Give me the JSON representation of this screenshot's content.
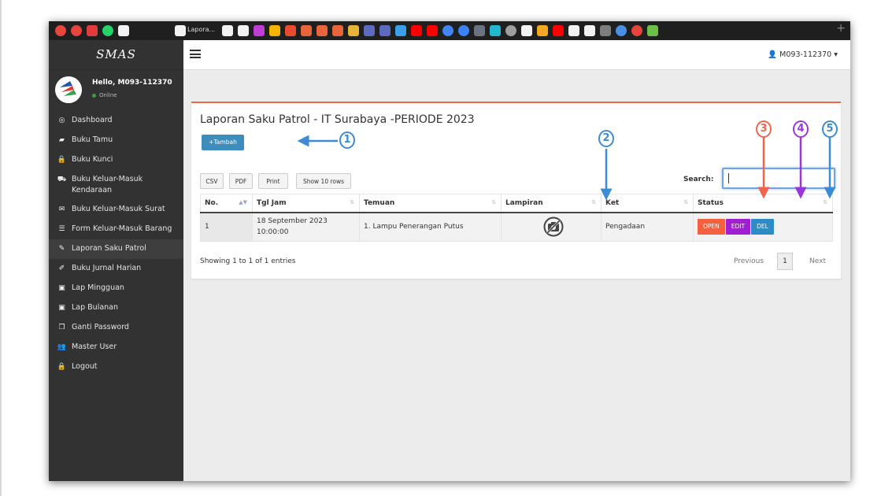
{
  "tabs": {
    "title": "Lapora...",
    "icons": [
      {
        "name": "google-icon",
        "color": "#e8453c",
        "round": true
      },
      {
        "name": "google-icon",
        "color": "#e8453c",
        "round": true
      },
      {
        "name": "app-icon",
        "color": "#e23b3b",
        "round": false
      },
      {
        "name": "whatsapp-icon",
        "color": "#25d366",
        "round": true
      },
      {
        "name": "github-icon",
        "color": "#f2f2f2",
        "round": false
      },
      {
        "name": "github-icon",
        "color": "#f2f2f2",
        "round": false
      },
      {
        "name": "github-icon",
        "color": "#f2f2f2",
        "round": false
      },
      {
        "name": "github-icon",
        "color": "#f2f2f2",
        "round": false
      },
      {
        "name": "slack-icon",
        "color": "#c13ed6",
        "round": false
      },
      {
        "name": "drive-icon",
        "color": "#f4b400",
        "round": false
      },
      {
        "name": "app-icon",
        "color": "#e84b2f",
        "round": false
      },
      {
        "name": "cp-icon",
        "color": "#e8643b",
        "round": false
      },
      {
        "name": "cp-icon",
        "color": "#e8643b",
        "round": false
      },
      {
        "name": "cp-icon",
        "color": "#e8643b",
        "round": false
      },
      {
        "name": "app-icon",
        "color": "#e6b33a",
        "round": false
      },
      {
        "name": "app-icon",
        "color": "#5c6bc0",
        "round": false
      },
      {
        "name": "app-icon",
        "color": "#5c6bc0",
        "round": false
      },
      {
        "name": "app-icon",
        "color": "#3aa0e8",
        "round": false
      },
      {
        "name": "youtube-icon",
        "color": "#ff0000",
        "round": false
      },
      {
        "name": "youtube-icon",
        "color": "#ff0000",
        "round": false
      },
      {
        "name": "google-icon",
        "color": "#4285f4",
        "round": true
      },
      {
        "name": "app-icon",
        "color": "#3b82f6",
        "round": true
      },
      {
        "name": "app-icon",
        "color": "#6b7280",
        "round": false
      },
      {
        "name": "app-icon",
        "color": "#22b8cf",
        "round": false
      },
      {
        "name": "app-icon",
        "color": "#9e9e9e",
        "round": true
      },
      {
        "name": "github-icon",
        "color": "#f2f2f2",
        "round": false
      },
      {
        "name": "app-icon",
        "color": "#f5a623",
        "round": false
      },
      {
        "name": "youtube-icon",
        "color": "#ff0000",
        "round": false
      },
      {
        "name": "github-icon",
        "color": "#f2f2f2",
        "round": false
      },
      {
        "name": "github-icon",
        "color": "#f2f2f2",
        "round": false
      },
      {
        "name": "app-icon",
        "color": "#7e7e7e",
        "round": false
      },
      {
        "name": "app-icon",
        "color": "#4a90e2",
        "round": true
      },
      {
        "name": "google-icon",
        "color": "#e8453c",
        "round": true
      },
      {
        "name": "app-icon",
        "color": "#6cc04a",
        "round": false
      }
    ]
  },
  "sidebar": {
    "brand": "SMAS",
    "greeting": "Hello, M093-112370",
    "status": "Online",
    "items": [
      {
        "label": "Dashboard",
        "icon": "dashboard-icon",
        "glyph": "◎"
      },
      {
        "label": "Buku Tamu",
        "icon": "book-icon",
        "glyph": "▰"
      },
      {
        "label": "Buku Kunci",
        "icon": "lock-icon",
        "glyph": "🔒"
      },
      {
        "label": "Buku Keluar-Masuk Kendaraan",
        "icon": "truck-icon",
        "glyph": "⛟"
      },
      {
        "label": "Buku Keluar-Masuk Surat",
        "icon": "envelope-icon",
        "glyph": "✉"
      },
      {
        "label": "Form Keluar-Masuk Barang",
        "icon": "list-icon",
        "glyph": "☰"
      },
      {
        "label": "Laporan Saku Patrol",
        "icon": "pencil-icon",
        "glyph": "✎"
      },
      {
        "label": "Buku Jurnal Harian",
        "icon": "magic-icon",
        "glyph": "✐"
      },
      {
        "label": "Lap Mingguan",
        "icon": "money-icon",
        "glyph": "▣"
      },
      {
        "label": "Lap Bulanan",
        "icon": "money-icon",
        "glyph": "▣"
      },
      {
        "label": "Ganti Password",
        "icon": "copy-icon",
        "glyph": "❐"
      },
      {
        "label": "Master User",
        "icon": "users-icon",
        "glyph": "👥"
      },
      {
        "label": "Logout",
        "icon": "lock-icon",
        "glyph": "🔒"
      }
    ],
    "active_index": 6
  },
  "topbar": {
    "user": "M093-112370"
  },
  "panel": {
    "title": "Laporan Saku Patrol - IT Surabaya -PERIODE 2023",
    "add_label": "Tambah",
    "export_buttons": [
      "CSV",
      "PDF",
      "Print",
      "Show 10 rows"
    ],
    "search_label": "Search:",
    "search_value": ""
  },
  "table": {
    "headers": [
      "No.",
      "Tgl Jam",
      "Temuan",
      "Lampiran",
      "Ket",
      "Status"
    ],
    "rows": [
      {
        "no": "1",
        "tgl_date": "18 September 2023",
        "tgl_time": "10:00:00",
        "temuan": "1. Lampu Penerangan Putus",
        "lampiran_icon": "no-photo-icon",
        "ket": "Pengadaan",
        "actions": [
          {
            "label": "OPEN",
            "color": "#f5613f"
          },
          {
            "label": "EDIT",
            "color": "#9f1fd3"
          },
          {
            "label": "DEL",
            "color": "#2e8bc6"
          }
        ]
      }
    ]
  },
  "pagination": {
    "info": "Showing 1 to 1 of 1 entries",
    "prev": "Previous",
    "page": "1",
    "next": "Next"
  },
  "annotations": [
    {
      "label": "1",
      "color": "#3b8bd6"
    },
    {
      "label": "2",
      "color": "#3b8bd6"
    },
    {
      "label": "3",
      "color": "#f0654b"
    },
    {
      "label": "4",
      "color": "#9b36d8"
    },
    {
      "label": "5",
      "color": "#3b8bd6"
    }
  ]
}
